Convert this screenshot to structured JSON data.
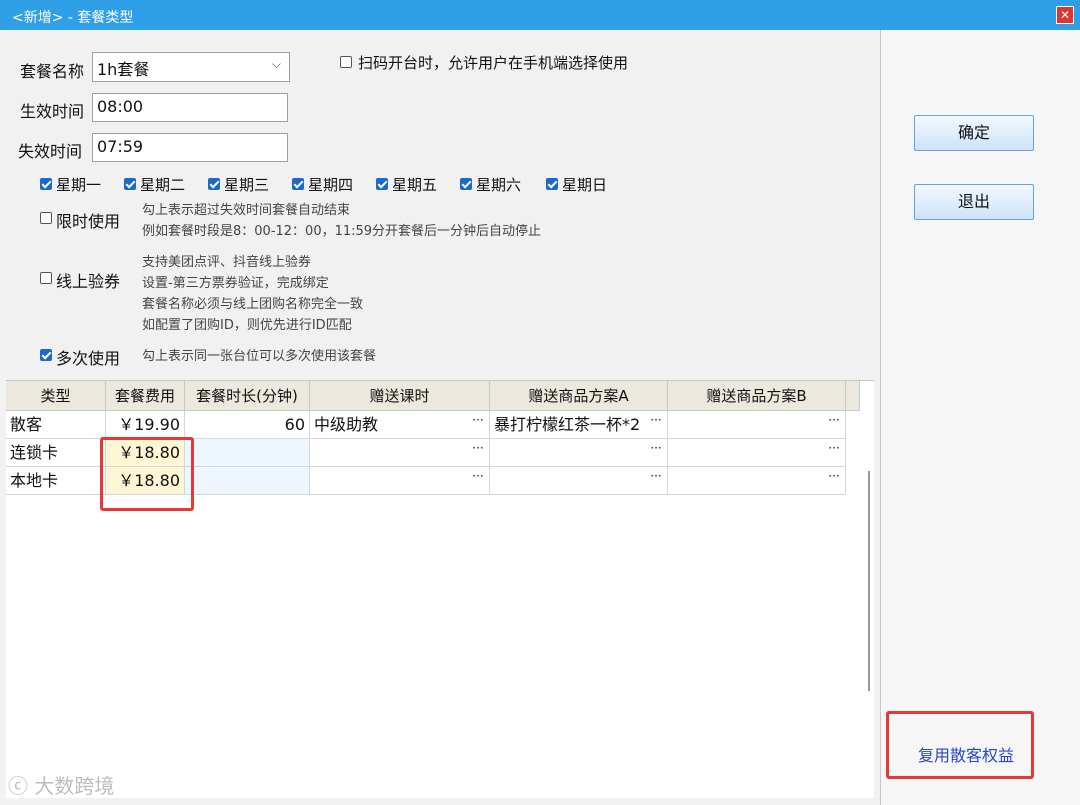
{
  "window": {
    "title": "<新增> - 套餐类型",
    "close_glyph": "✕"
  },
  "form": {
    "name_label": "套餐名称",
    "name_value": "1h套餐",
    "scan_option": "扫码开台时，允许用户在手机端选择使用",
    "start_label": "生效时间",
    "start_value": "08:00",
    "end_label": "失效时间",
    "end_value": "07:59",
    "weekdays": [
      "星期一",
      "星期二",
      "星期三",
      "星期四",
      "星期五",
      "星期六",
      "星期日"
    ],
    "limit_label": "限时使用",
    "limit_notes": [
      "勾上表示超过失效时间套餐自动结束",
      "例如套餐时段是8：00-12：00，11:59分开套餐后一分钟后自动停止"
    ],
    "online_label": "线上验券",
    "online_notes": [
      "支持美团点评、抖音线上验券",
      "设置-第三方票券验证，完成绑定",
      "套餐名称必须与线上团购名称完全一致",
      "如配置了团购ID，则优先进行ID匹配"
    ],
    "multi_label": "多次使用",
    "multi_note": "勾上表示同一张台位可以多次使用该套餐"
  },
  "table": {
    "headers": [
      "类型",
      "套餐费用",
      "套餐时长(分钟)",
      "赠送课时",
      "赠送商品方案A",
      "赠送商品方案B"
    ],
    "rows": [
      {
        "type": "散客",
        "fee": "￥19.90",
        "duration": "60",
        "lesson": "中级助教",
        "goods_a": "暴打柠檬红茶一杯*2",
        "goods_b": ""
      },
      {
        "type": "连锁卡",
        "fee": "￥18.80",
        "duration": "",
        "lesson": "",
        "goods_a": "",
        "goods_b": ""
      },
      {
        "type": "本地卡",
        "fee": "￥18.80",
        "duration": "",
        "lesson": "",
        "goods_a": "",
        "goods_b": ""
      }
    ],
    "ellipsis": "···"
  },
  "buttons": {
    "confirm": "确定",
    "exit": "退出"
  },
  "reuse_link": "复用散客权益",
  "watermark": "大数跨境",
  "colors": {
    "titlebar": "#2f9fe8",
    "highlight": "#e53935",
    "fee_cell": "#fff6d5",
    "link": "#2b45c9"
  }
}
